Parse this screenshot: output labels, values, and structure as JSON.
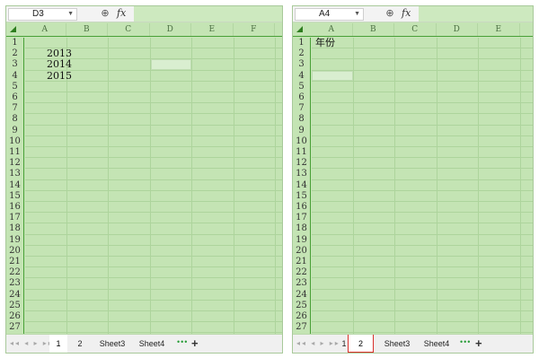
{
  "panels": [
    {
      "name_box": "D3",
      "columns": [
        "A",
        "B",
        "C",
        "D",
        "E",
        "F"
      ],
      "rows": [
        "1",
        "2",
        "3",
        "4",
        "5",
        "6",
        "7",
        "8",
        "9",
        "10",
        "11",
        "12",
        "13",
        "14",
        "15",
        "16",
        "17",
        "18",
        "19",
        "20",
        "21",
        "22",
        "23",
        "24",
        "25",
        "26",
        "27"
      ],
      "cells": [
        {
          "ref": "A2",
          "text": "2013"
        },
        {
          "ref": "A3",
          "text": "2014"
        },
        {
          "ref": "A4",
          "text": "2015"
        }
      ],
      "selected_cell": "D3",
      "sheet_tabs": [
        "1",
        "2",
        "Sheet3",
        "Sheet4"
      ],
      "active_tab": "1",
      "more_tabs": "•••",
      "add_sheet": "+",
      "nav_arrows": "◂◂ ◂ ▸ ▸▸"
    },
    {
      "name_box": "A4",
      "columns": [
        "A",
        "B",
        "C",
        "D",
        "E"
      ],
      "rows": [
        "1",
        "2",
        "3",
        "4",
        "5",
        "6",
        "7",
        "8",
        "9",
        "10",
        "11",
        "12",
        "13",
        "14",
        "15",
        "16",
        "17",
        "18",
        "19",
        "20",
        "21",
        "22",
        "23",
        "24",
        "25",
        "26",
        "27"
      ],
      "cells": [
        {
          "ref": "A1",
          "text": "年份"
        }
      ],
      "selected_cell": "A4",
      "sheet_tabs": [
        "1",
        "2",
        "Sheet3",
        "Sheet4"
      ],
      "active_tab": "2",
      "more_tabs": "•••",
      "add_sheet": "+",
      "nav_arrows": "◂◂ ◂ ▸ ▸▸"
    }
  ],
  "icons": {
    "zoom": "magnifier-icon",
    "function": "fx-icon"
  },
  "labels": {
    "fx": "fx",
    "zoom_glyph": "⊕"
  },
  "colors": {
    "grid_bg": "#c4e4b4",
    "header_line": "#49a037",
    "tab_highlight": "#d9302b"
  }
}
